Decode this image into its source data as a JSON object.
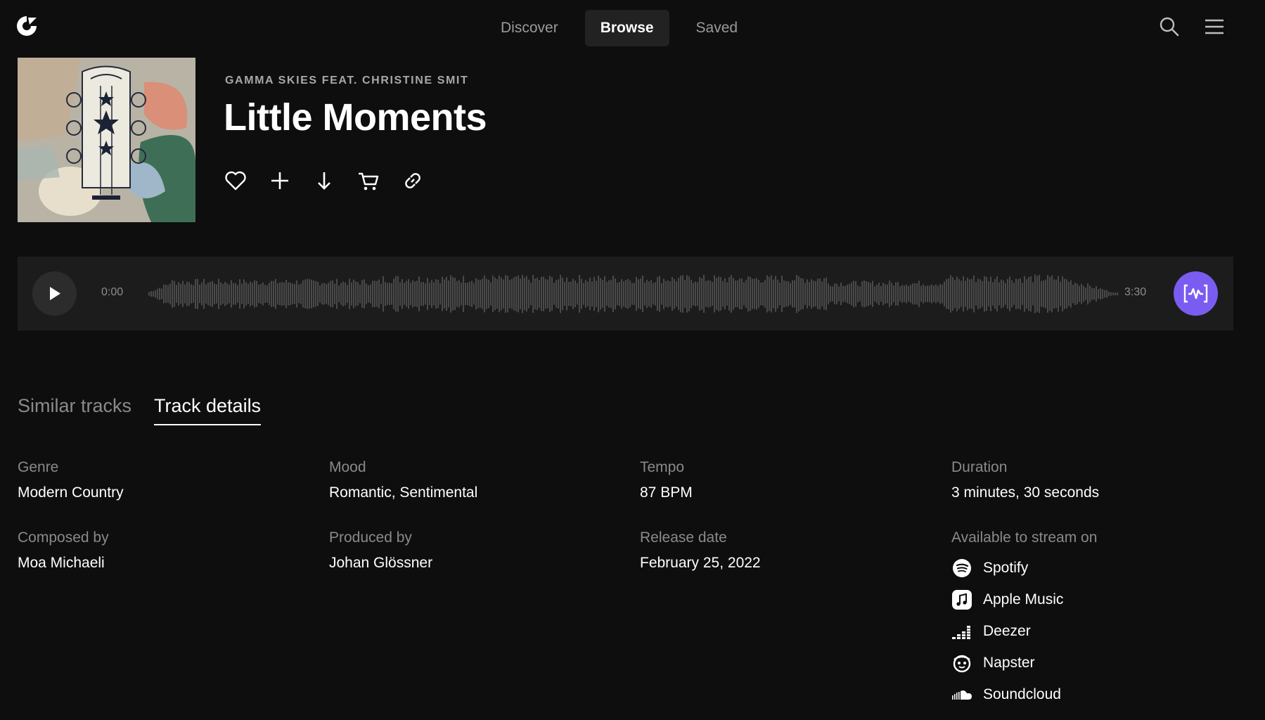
{
  "nav": {
    "tabs": [
      {
        "label": "Discover"
      },
      {
        "label": "Browse"
      },
      {
        "label": "Saved"
      }
    ]
  },
  "track": {
    "artist": "GAMMA SKIES FEAT. CHRISTINE SMIT",
    "title": "Little Moments"
  },
  "player": {
    "current_time": "0:00",
    "total_time": "3:30",
    "accent_color": "#7b5cf0"
  },
  "tabs": [
    {
      "label": "Similar tracks"
    },
    {
      "label": "Track details"
    }
  ],
  "details": {
    "genre": {
      "label": "Genre",
      "value": "Modern Country"
    },
    "mood": {
      "label": "Mood",
      "value": "Romantic, Sentimental"
    },
    "tempo": {
      "label": "Tempo",
      "value": "87 BPM"
    },
    "duration": {
      "label": "Duration",
      "value": "3 minutes, 30 seconds"
    },
    "composed": {
      "label": "Composed by",
      "value": "Moa Michaeli"
    },
    "produced": {
      "label": "Produced by",
      "value": "Johan Glössner"
    },
    "release": {
      "label": "Release date",
      "value": "February 25, 2022"
    },
    "stream": {
      "label": "Available to stream on",
      "services": [
        {
          "name": "Spotify",
          "icon": "spotify-icon"
        },
        {
          "name": "Apple Music",
          "icon": "apple-music-icon"
        },
        {
          "name": "Deezer",
          "icon": "deezer-icon"
        },
        {
          "name": "Napster",
          "icon": "napster-icon"
        },
        {
          "name": "Soundcloud",
          "icon": "soundcloud-icon"
        }
      ]
    }
  }
}
